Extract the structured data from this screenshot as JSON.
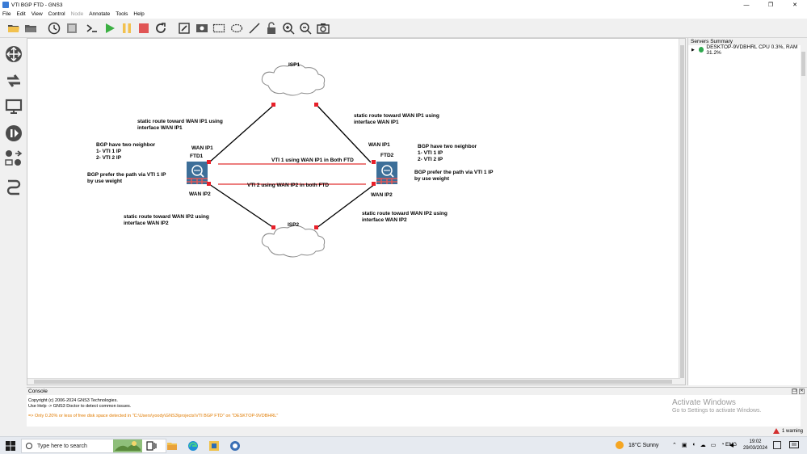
{
  "window": {
    "title": "VTI BGP FTD - GNS3",
    "buttons": {
      "minimize": "—",
      "maximize": "❐",
      "close": "✕"
    }
  },
  "menu": [
    "File",
    "Edit",
    "View",
    "Control",
    "Node",
    "Annotate",
    "Tools",
    "Help"
  ],
  "menu_disabled": [
    "Node"
  ],
  "toolbar": [
    "open-folder-icon",
    "folder-icon",
    "clock-icon",
    "snapshot-icon",
    "console-icon",
    "play-icon",
    "pause-icon",
    "stop-icon",
    "reload-icon",
    "edit-note-icon",
    "image-icon",
    "rectangle-icon",
    "ellipse-icon",
    "line-icon",
    "lock-icon",
    "zoom-in-icon",
    "zoom-out-icon",
    "screenshot-icon"
  ],
  "node_palette": [
    "routers-icon",
    "switches-icon",
    "end-devices-icon",
    "security-devices-icon",
    "all-devices-icon",
    "add-link-icon"
  ],
  "topology": {
    "nodes": {
      "isp1": "ISP1",
      "isp2": "ISP2",
      "ftd1": "FTD1",
      "ftd2": "FTD2"
    },
    "interfaces": {
      "ftd1_wan1": "WAN IP1",
      "ftd1_wan2": "WAN IP2",
      "ftd2_wan1": "WAN IP1",
      "ftd2_wan2": "WAN IP2"
    },
    "tunnels": {
      "vti1": "VTI 1 using WAN IP1 in Both FTD",
      "vti2": "VTI 2 using WAN IP2 in both FTD"
    },
    "notes": {
      "left_static1": [
        "static route toward WAN IP1 using",
        "interface WAN IP1"
      ],
      "right_static1": [
        "static route toward WAN IP1 using",
        "interface WAN IP1"
      ],
      "left_bgp": [
        "BGP have two neighbor",
        "1- VTI 1 IP",
        "2- VTI 2 IP"
      ],
      "right_bgp": [
        "BGP have two neighbor",
        "1- VTI 1 IP",
        "2- VTI 2 IP"
      ],
      "left_prefer": [
        "BGP prefer the path via VTI 1 IP",
        "by use weight"
      ],
      "right_prefer": [
        "BGP prefer the path via VTI 1 IP",
        "by use weight"
      ],
      "left_static2": [
        "static route toward WAN IP2 using",
        "interface WAN IP2"
      ],
      "right_static2": [
        "static route toward WAN IP2 using",
        "interface WAN IP2"
      ]
    },
    "colors": {
      "link": "#000000",
      "tunnel": "#e03030",
      "port": "#e8202a",
      "firewall": "#3d6f99"
    }
  },
  "servers": {
    "title": "Servers Summary",
    "entry": "DESKTOP-9VDBHRL CPU 0.3%, RAM 31.2%",
    "status_color": "#2fa84f"
  },
  "console": {
    "title": "Console",
    "lines": [
      "Copyright (c) 2006-2024 GNS3 Technologies.",
      "Use Help -> GNS3 Doctor to detect common issues."
    ],
    "warning": "=> Only 0.20% or less of free disk space detected in \"C:\\Users\\yoody\\GNS3\\projects\\VTI BGP FTD\" on \"DESKTOP-9VDBHRL\""
  },
  "watermark": {
    "line1": "Activate Windows",
    "line2": "Go to Settings to activate Windows."
  },
  "status": {
    "warnings": "1 warning"
  },
  "taskbar": {
    "search_placeholder": "Type here to search",
    "weather": "18°C  Sunny",
    "language": "ENG",
    "time": "19:02",
    "date": "29/03/2024"
  }
}
